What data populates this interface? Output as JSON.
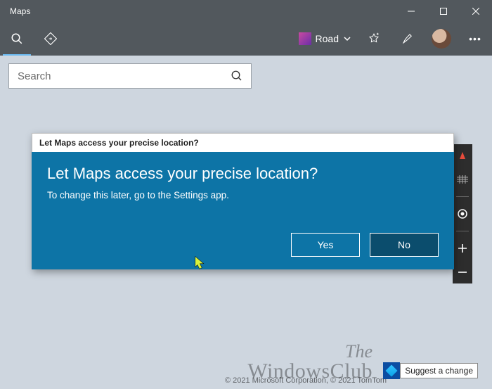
{
  "window": {
    "title": "Maps"
  },
  "toolbar": {
    "view_label": "Road"
  },
  "search": {
    "placeholder": "Search",
    "value": ""
  },
  "dialog": {
    "header": "Let Maps access your precise location?",
    "title": "Let Maps access your precise location?",
    "message": "To change this later, go to the Settings app.",
    "yes_label": "Yes",
    "no_label": "No"
  },
  "footer": {
    "suggest_label": "Suggest a change",
    "copyright": "© 2021 Microsoft Corporation, © 2021 TomTom"
  },
  "watermark": {
    "line1": "The",
    "line2": "WindowsClub"
  }
}
